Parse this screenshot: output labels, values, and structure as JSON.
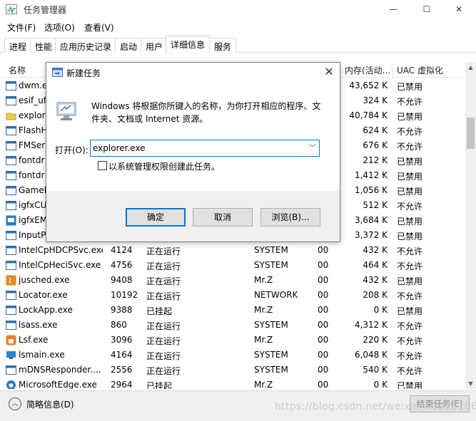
{
  "window": {
    "title": "任务管理器",
    "caption_buttons": [
      "—",
      "☐",
      "✕"
    ]
  },
  "menu": [
    "文件(F)",
    "选项(O)",
    "查看(V)"
  ],
  "tabs": [
    {
      "label": "进程"
    },
    {
      "label": "性能"
    },
    {
      "label": "应用历史记录"
    },
    {
      "label": "启动"
    },
    {
      "label": "用户"
    },
    {
      "label": "详细信息",
      "active": true
    },
    {
      "label": "服务"
    }
  ],
  "table": {
    "headers": {
      "name": "名称",
      "memory": "内存(活动...",
      "uac": "UAC 虚拟化"
    },
    "rows": [
      {
        "name": "dwm.e",
        "pid": "",
        "status": "",
        "user": "",
        "cpu": "",
        "mem": "43,652 K",
        "uac": "已禁用",
        "icon": "blue"
      },
      {
        "name": "esif_uf.",
        "pid": "",
        "status": "",
        "user": "",
        "cpu": "",
        "mem": "324 K",
        "uac": "不允许",
        "icon": "blue"
      },
      {
        "name": "explor",
        "pid": "",
        "status": "",
        "user": "",
        "cpu": "",
        "mem": "40,784 K",
        "uac": "已禁用",
        "icon": "folder"
      },
      {
        "name": "FlashH",
        "pid": "",
        "status": "",
        "user": "",
        "cpu": "",
        "mem": "624 K",
        "uac": "不允许",
        "icon": "blue"
      },
      {
        "name": "FMSer",
        "pid": "",
        "status": "",
        "user": "",
        "cpu": "",
        "mem": "676 K",
        "uac": "不允许",
        "icon": "blue"
      },
      {
        "name": "fontdr",
        "pid": "",
        "status": "",
        "user": "",
        "cpu": "",
        "mem": "212 K",
        "uac": "已禁用",
        "icon": "blue"
      },
      {
        "name": "fontdr",
        "pid": "",
        "status": "",
        "user": "",
        "cpu": "",
        "mem": "1,412 K",
        "uac": "已禁用",
        "icon": "blue"
      },
      {
        "name": "GameB",
        "pid": "",
        "status": "",
        "user": "",
        "cpu": "",
        "mem": "1,056 K",
        "uac": "已禁用",
        "icon": "blue"
      },
      {
        "name": "igfxCU",
        "pid": "",
        "status": "",
        "user": "",
        "cpu": "",
        "mem": "512 K",
        "uac": "不允许",
        "icon": "blue"
      },
      {
        "name": "igfxEM",
        "pid": "",
        "status": "",
        "user": "",
        "cpu": "",
        "mem": "3,684 K",
        "uac": "已禁用",
        "icon": "igfx"
      },
      {
        "name": "InputP",
        "pid": "",
        "status": "",
        "user": "",
        "cpu": "",
        "mem": "3,372 K",
        "uac": "已禁用",
        "icon": "blue"
      },
      {
        "name": "IntelCpHDCPSvc.exe",
        "pid": "4124",
        "status": "正在运行",
        "user": "SYSTEM",
        "cpu": "00",
        "mem": "432 K",
        "uac": "不允许",
        "icon": "blue"
      },
      {
        "name": "IntelCpHeciSvc.exe",
        "pid": "4756",
        "status": "正在运行",
        "user": "SYSTEM",
        "cpu": "00",
        "mem": "464 K",
        "uac": "不允许",
        "icon": "blue"
      },
      {
        "name": "jusched.exe",
        "pid": "9408",
        "status": "正在运行",
        "user": "Mr.Z",
        "cpu": "00",
        "mem": "432 K",
        "uac": "已禁用",
        "icon": "java"
      },
      {
        "name": "Locator.exe",
        "pid": "10192",
        "status": "正在运行",
        "user": "NETWORK ...",
        "cpu": "00",
        "mem": "208 K",
        "uac": "不允许",
        "icon": "blue"
      },
      {
        "name": "LockApp.exe",
        "pid": "9388",
        "status": "已挂起",
        "user": "Mr.Z",
        "cpu": "00",
        "mem": "0 K",
        "uac": "已禁用",
        "icon": "blue"
      },
      {
        "name": "lsass.exe",
        "pid": "860",
        "status": "正在运行",
        "user": "SYSTEM",
        "cpu": "00",
        "mem": "4,312 K",
        "uac": "不允许",
        "icon": "blue"
      },
      {
        "name": "Lsf.exe",
        "pid": "3096",
        "status": "正在运行",
        "user": "Mr.Z",
        "cpu": "00",
        "mem": "220 K",
        "uac": "不允许",
        "icon": "lsf"
      },
      {
        "name": "lsmain.exe",
        "pid": "4164",
        "status": "正在运行",
        "user": "SYSTEM",
        "cpu": "00",
        "mem": "6,048 K",
        "uac": "不允许",
        "icon": "monitor"
      },
      {
        "name": "mDNSResponder....",
        "pid": "2556",
        "status": "正在运行",
        "user": "SYSTEM",
        "cpu": "00",
        "mem": "540 K",
        "uac": "不允许",
        "icon": "blue"
      },
      {
        "name": "MicrosoftEdge.exe",
        "pid": "2964",
        "status": "已挂起",
        "user": "Mr.Z",
        "cpu": "00",
        "mem": "0 K",
        "uac": "已禁用",
        "icon": "edge"
      }
    ]
  },
  "bottom": {
    "fewer_details": "简略信息(D)",
    "end_task": "结束任务(E)",
    "watermark": "https://blog.csdn.net/weixin_40825186"
  },
  "dialog": {
    "title": "新建任务",
    "description": "Windows 将根据你所键入的名称，为你打开相应的程序、文件夹、文档或 Internet 资源。",
    "open_label": "打开(O):",
    "input_value": "explorer.exe",
    "admin_checkbox_label": "以系统管理权限创建此任务。",
    "admin_checked": false,
    "buttons": {
      "ok": "确定",
      "cancel": "取消",
      "browse": "浏览(B)..."
    }
  },
  "colors": {
    "accent": "#0078d7",
    "icon_blue": "#2b6cb0"
  }
}
